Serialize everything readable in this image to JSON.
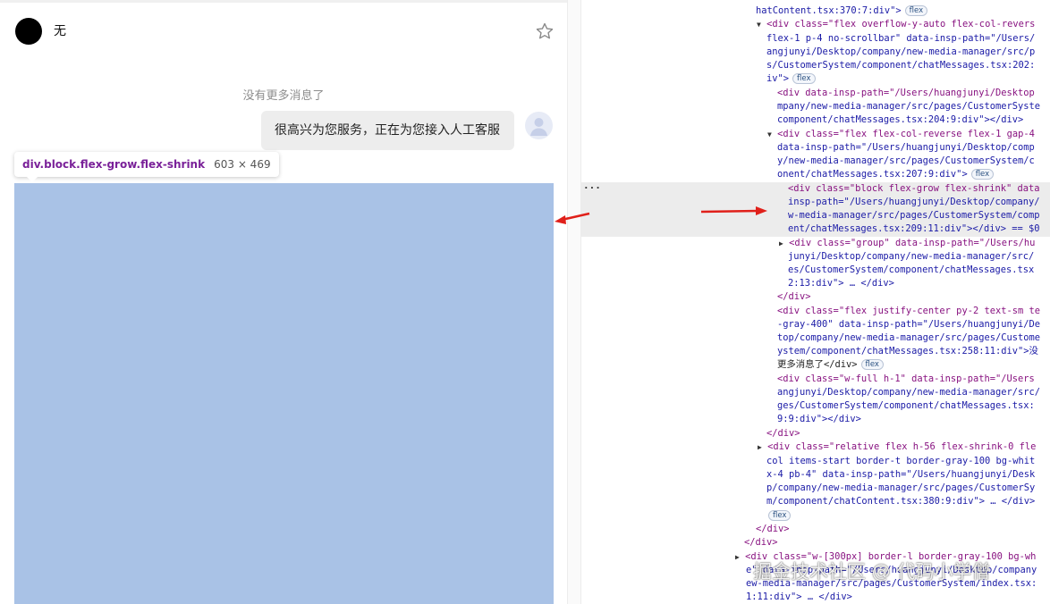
{
  "chat": {
    "contact_name": "无",
    "no_more_messages": "没有更多消息了",
    "message": "很高兴为您服务，正在为您接入人工客服"
  },
  "inspector": {
    "selector": "div.block.flex-grow.flex-shrink",
    "size": "603 × 469",
    "highlight_color": "#a9c2e6"
  },
  "devtools": {
    "lines": [
      [
        "hatContent.tsx:370:7:div\">",
        "flex"
      ],
      [
        "<div class=\"flex overflow-y-auto flex-col-revers",
        ""
      ],
      [
        "flex-1 p-4 no-scrollbar\" data-insp-path=\"/Users/",
        ""
      ],
      [
        "angjunyi/Desktop/company/new-media-manager/src/p",
        ""
      ],
      [
        "s/CustomerSystem/component/chatMessages.tsx:202:",
        ""
      ],
      [
        "iv\">",
        "flex"
      ],
      [
        "<div data-insp-path=\"/Users/huangjunyi/Desktop",
        ""
      ],
      [
        "mpany/new-media-manager/src/pages/CustomerSyste",
        ""
      ],
      [
        "component/chatMessages.tsx:204:9:div\"></div>",
        ""
      ],
      [
        "<div class=\"flex flex-col-reverse flex-1 gap-4",
        ""
      ],
      [
        "data-insp-path=\"/Users/huangjunyi/Desktop/comp",
        ""
      ],
      [
        "y/new-media-manager/src/pages/CustomerSystem/c",
        ""
      ],
      [
        "onent/chatMessages.tsx:207:9:div\">",
        "flex"
      ],
      [
        "<div class=\"block flex-grow flex-shrink\" data",
        ""
      ],
      [
        "insp-path=\"/Users/huangjunyi/Desktop/company/",
        ""
      ],
      [
        "w-media-manager/src/pages/CustomerSystem/comp",
        ""
      ],
      [
        "ent/chatMessages.tsx:209:11:div\"></div> == $0",
        ""
      ],
      [
        "<div class=\"group\" data-insp-path=\"/Users/hu",
        ""
      ],
      [
        "junyi/Desktop/company/new-media-manager/src/",
        ""
      ],
      [
        "es/CustomerSystem/component/chatMessages.tsx",
        ""
      ],
      [
        "2:13:div\"> … </div>",
        ""
      ],
      [
        "</div>",
        ""
      ],
      [
        "<div class=\"flex justify-center py-2 text-sm te",
        ""
      ],
      [
        "-gray-400\" data-insp-path=\"/Users/huangjunyi/De",
        ""
      ],
      [
        "top/company/new-media-manager/src/pages/Custome",
        ""
      ],
      [
        "ystem/component/chatMessages.tsx:258:11:div\">没",
        ""
      ],
      [
        "更多消息了</div>",
        "flex"
      ],
      [
        "<div class=\"w-full h-1\" data-insp-path=\"/Users",
        ""
      ],
      [
        "angjunyi/Desktop/company/new-media-manager/src/",
        ""
      ],
      [
        "ges/CustomerSystem/component/chatMessages.tsx:",
        ""
      ],
      [
        "9:9:div\"></div>",
        ""
      ],
      [
        "</div>",
        ""
      ],
      [
        "<div class=\"relative flex h-56 flex-shrink-0 fle",
        ""
      ],
      [
        "col items-start border-t border-gray-100 bg-whit",
        ""
      ],
      [
        "x-4 pb-4\" data-insp-path=\"/Users/huangjunyi/Desk",
        ""
      ],
      [
        "p/company/new-media-manager/src/pages/CustomerSy",
        ""
      ],
      [
        "m/component/chatContent.tsx:380:9:div\"> … </div>",
        ""
      ],
      [
        "",
        "flex"
      ],
      [
        "</div>",
        ""
      ],
      [
        "</div>",
        ""
      ],
      [
        "<div class=\"w-[300px] border-l border-gray-100 bg-wh",
        ""
      ],
      [
        "e\" data-insp-path=\"/Users/huangjunyi/Desktop/company",
        ""
      ],
      [
        "ew-media-manager/src/pages/CustomerSystem/index.tsx:",
        ""
      ],
      [
        "1:11:div\"> … </div>",
        ""
      ]
    ]
  },
  "watermark": "掘金技术社区 @ 代码小学僧"
}
